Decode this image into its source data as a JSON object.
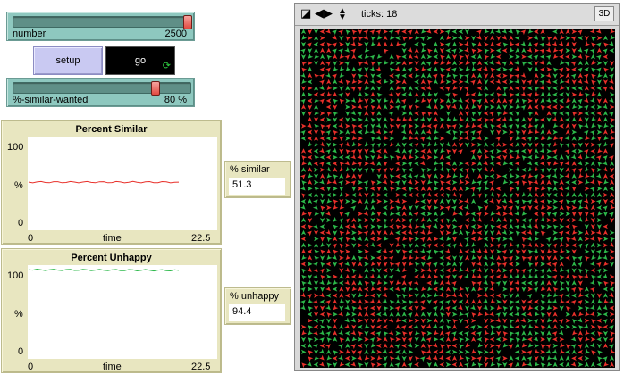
{
  "sliders": [
    {
      "label": "number",
      "value_text": "2500",
      "fraction": 0.98
    },
    {
      "label": "%-similar-wanted",
      "value_text": "80 %",
      "fraction": 0.8
    }
  ],
  "buttons": {
    "setup": "setup",
    "go": "go"
  },
  "plots": [
    {
      "title": "Percent Similar",
      "ylabel": "%",
      "xlabel": "time",
      "y_max_label": "100",
      "y_min_label": "0",
      "x_min_label": "0",
      "x_max_label": "22.5",
      "color": "#e8302a",
      "chart_data": {
        "type": "line",
        "x": [
          0,
          18
        ],
        "values": [
          51.3,
          51.3
        ],
        "xlim": [
          0,
          22.5
        ],
        "ylim": [
          0,
          100
        ]
      }
    },
    {
      "title": "Percent Unhappy",
      "ylabel": "%",
      "xlabel": "time",
      "y_max_label": "100",
      "y_min_label": "0",
      "x_min_label": "0",
      "x_max_label": "22.5",
      "color": "#2cb84a",
      "chart_data": {
        "type": "line",
        "x": [
          0,
          18
        ],
        "values": [
          95,
          94.4
        ],
        "xlim": [
          0,
          22.5
        ],
        "ylim": [
          0,
          100
        ]
      }
    }
  ],
  "monitors": [
    {
      "label": "% similar",
      "value": "51.3"
    },
    {
      "label": "% unhappy",
      "value": "94.4"
    }
  ],
  "view": {
    "ticks_label": "ticks: 18",
    "button_3d": "3D",
    "turtle_colors": [
      "#e8302a",
      "#2cb84a"
    ]
  }
}
